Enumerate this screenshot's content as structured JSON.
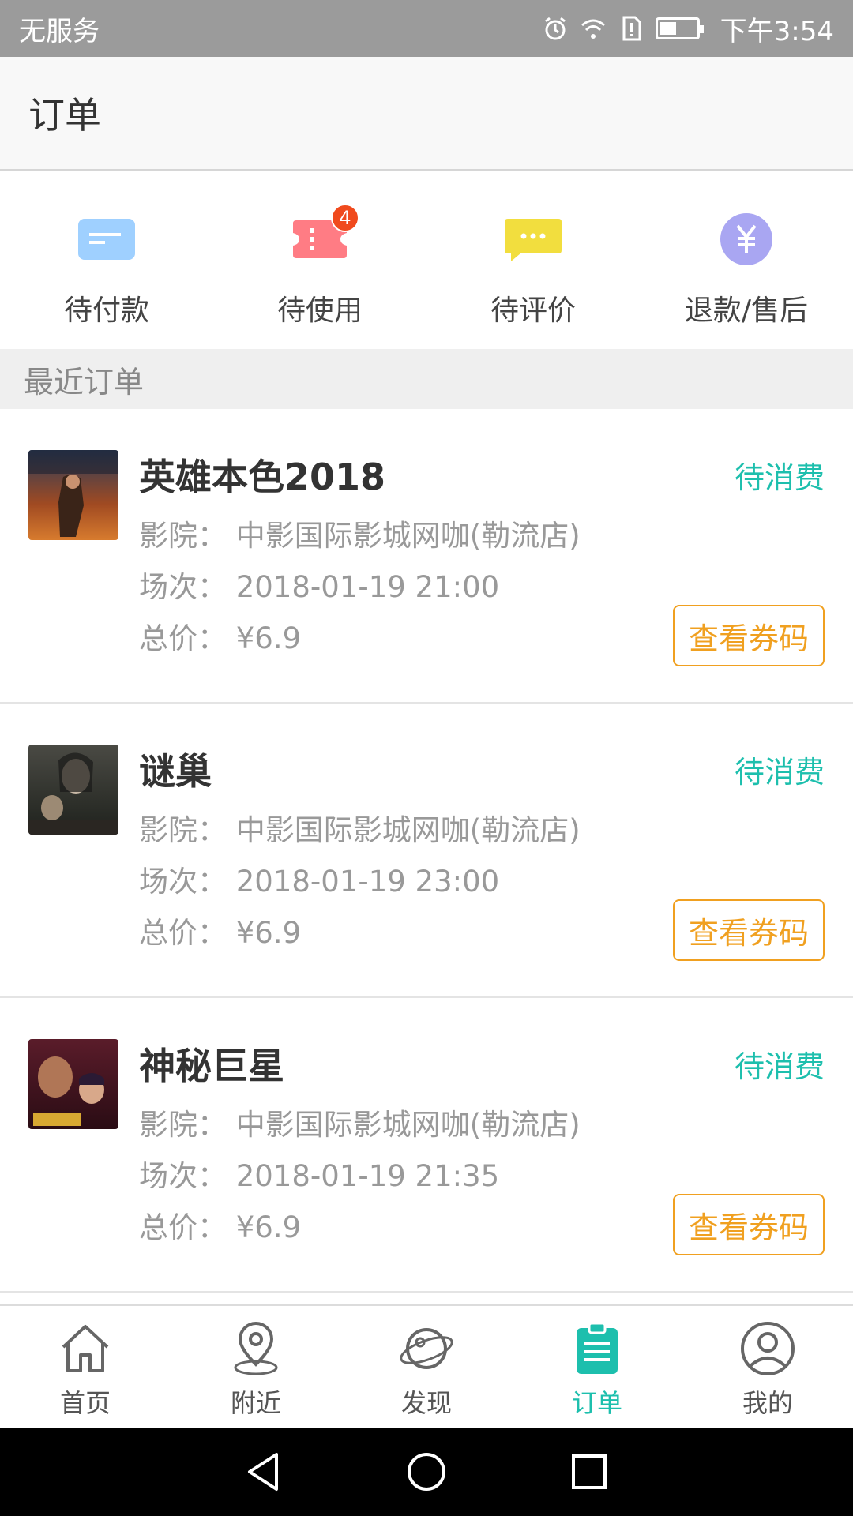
{
  "status_bar": {
    "carrier": "无服务",
    "time": "下午3:54"
  },
  "header": {
    "title": "订单"
  },
  "categories": [
    {
      "label": "待付款",
      "icon": "wallet-icon",
      "color": "#9fd0ff"
    },
    {
      "label": "待使用",
      "icon": "ticket-icon",
      "color": "#ff7c84",
      "badge": "4"
    },
    {
      "label": "待评价",
      "icon": "comment-icon",
      "color": "#f2de3e"
    },
    {
      "label": "退款/售后",
      "icon": "yen-icon",
      "color": "#a9a6f2"
    }
  ],
  "section": {
    "title": "最近订单"
  },
  "orders": [
    {
      "name": "英雄本色2018",
      "status": "待消费",
      "cinema": "影院：  中影国际影城网咖(勒流店)",
      "showtime": "场次：  2018-01-19 21:00",
      "price": "总价：  ¥6.9",
      "button": "查看券码"
    },
    {
      "name": "谜巢",
      "status": "待消费",
      "cinema": "影院：  中影国际影城网咖(勒流店)",
      "showtime": "场次：  2018-01-19 23:00",
      "price": "总价：  ¥6.9",
      "button": "查看券码"
    },
    {
      "name": "神秘巨星",
      "status": "待消费",
      "cinema": "影院：  中影国际影城网咖(勒流店)",
      "showtime": "场次：  2018-01-19 21:35",
      "price": "总价：  ¥6.9",
      "button": "查看券码"
    }
  ],
  "tabbar": [
    {
      "label": "首页",
      "icon": "home-icon"
    },
    {
      "label": "附近",
      "icon": "location-pin-icon"
    },
    {
      "label": "发现",
      "icon": "planet-icon"
    },
    {
      "label": "订单",
      "icon": "clipboard-icon",
      "active": true
    },
    {
      "label": "我的",
      "icon": "user-icon"
    }
  ],
  "colors": {
    "accent": "#1dbfad",
    "button": "#f0a020",
    "badge": "#f04a1d"
  }
}
